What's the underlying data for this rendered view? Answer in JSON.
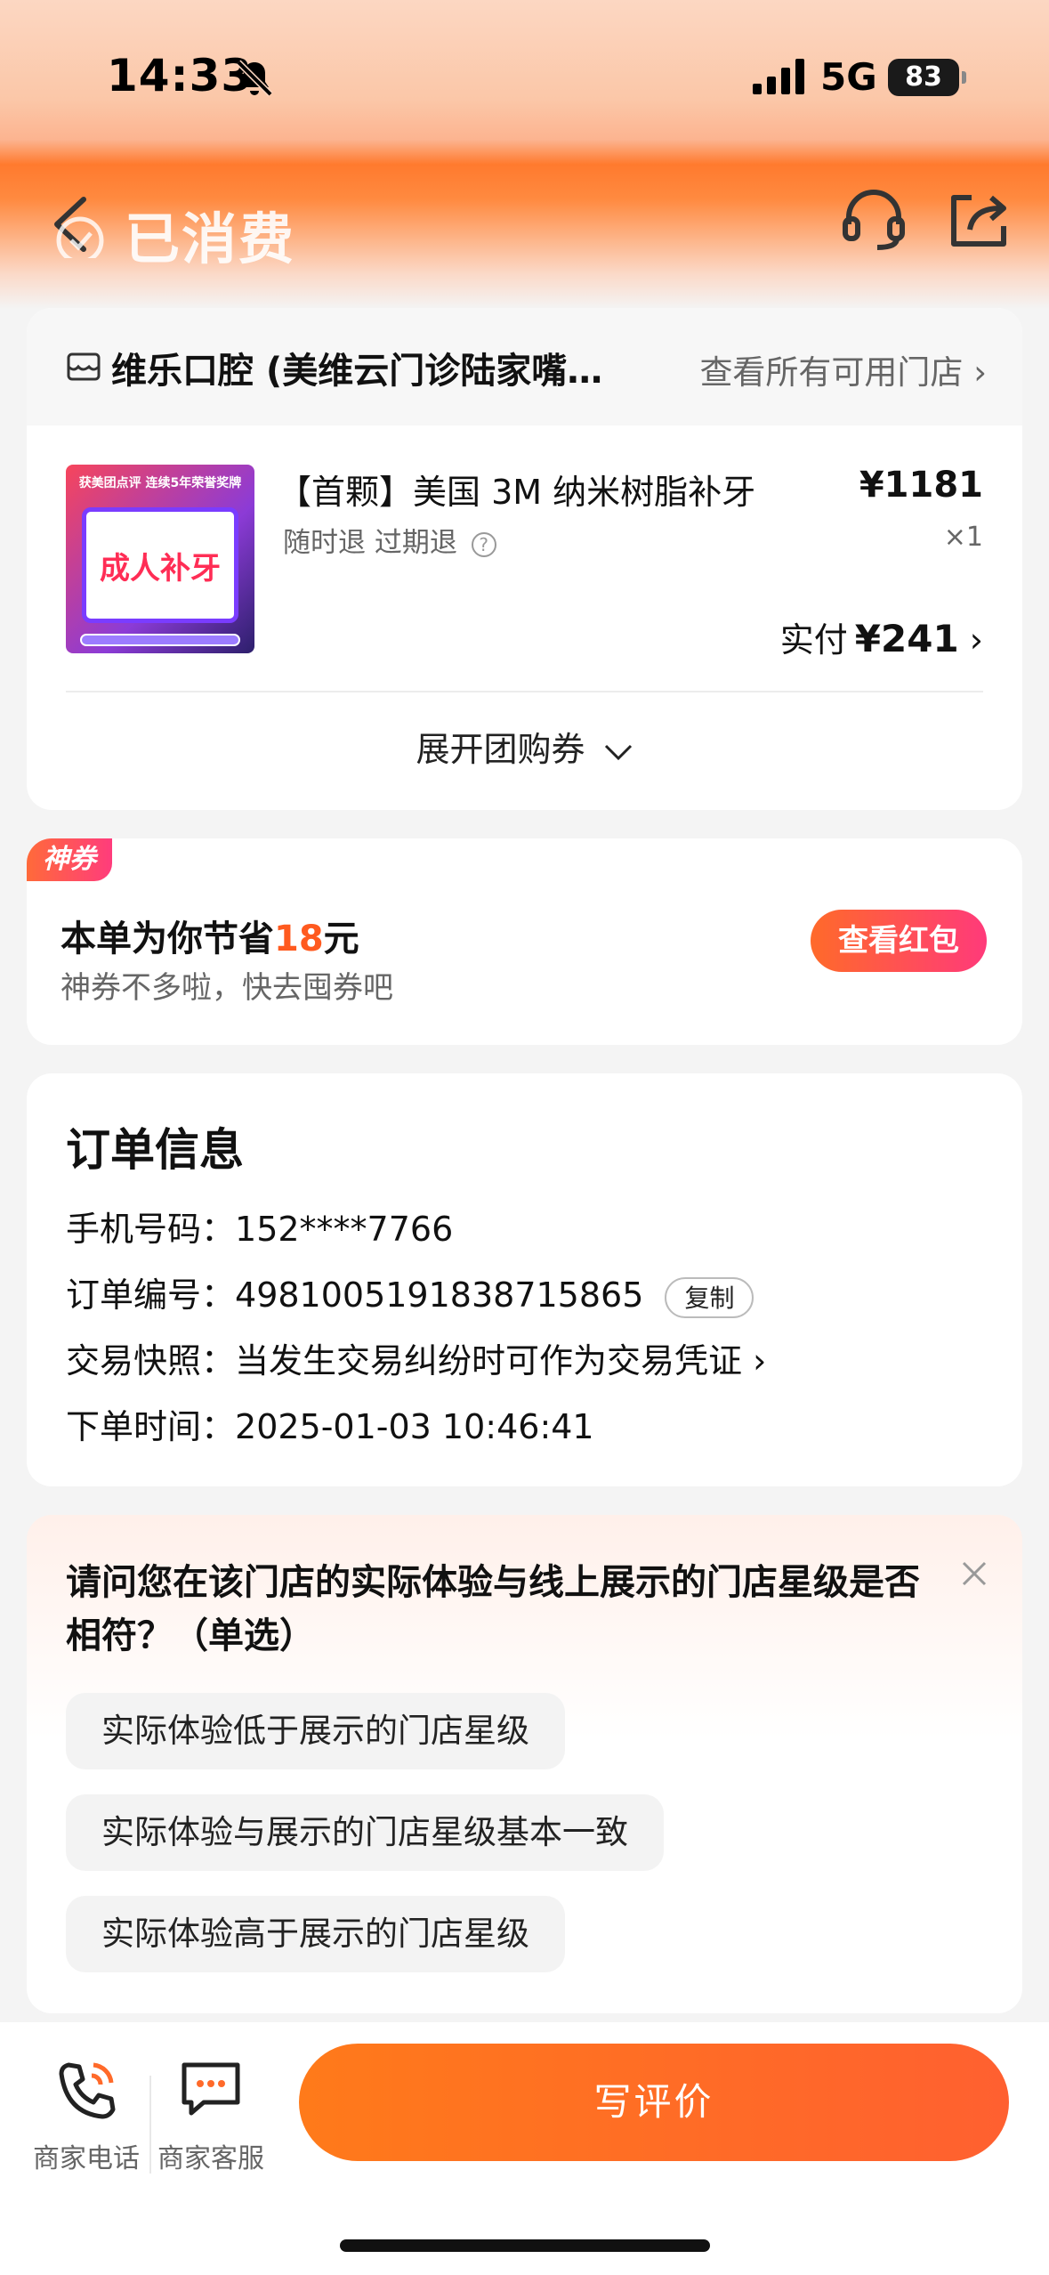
{
  "status_bar": {
    "time": "14:33",
    "network": "5G",
    "battery": "83"
  },
  "nav": {
    "title": "已消费"
  },
  "store": {
    "name": "维乐口腔 (美维云门诊陆家嘴…",
    "all_stores_link": "查看所有可用门店",
    "product": {
      "name": "【首颗】美国 3M 纳米树脂补牙",
      "tags": "随时退 过期退",
      "price": "¥1181",
      "quantity": "×1",
      "paid_label": "实付",
      "paid_amount": "¥241",
      "thumb_title": "成人补牙",
      "thumb_top": "获美团点评 连续5年荣誉奖牌"
    },
    "expand_label": "展开团购券"
  },
  "coupon": {
    "badge": "神券",
    "title_prefix": "本单为你节省",
    "amount": "18",
    "title_suffix": "元",
    "subtitle": "神券不多啦，快去囤券吧",
    "button": "查看红包"
  },
  "order": {
    "title": "订单信息",
    "phone_label": "手机号码：",
    "phone_value": "152****7766",
    "order_no_label": "订单编号：",
    "order_no_value": "4981005191838715865",
    "copy_button": "复制",
    "snapshot_label": "交易快照：",
    "snapshot_value": "当发生交易纠纷时可作为交易凭证",
    "time_label": "下单时间：",
    "time_value": "2025-01-03 10:46:41"
  },
  "survey": {
    "question": "请问您在该门店的实际体验与线上展示的门店星级是否相符？（单选）",
    "options": [
      "实际体验低于展示的门店星级",
      "实际体验与展示的门店星级基本一致",
      "实际体验高于展示的门店星级"
    ]
  },
  "bottom_bar": {
    "phone_label": "商家电话",
    "service_label": "商家客服",
    "review_button": "写评价"
  },
  "colors": {
    "accent": "#ff7a1a",
    "highlight": "#ff5a1f"
  }
}
